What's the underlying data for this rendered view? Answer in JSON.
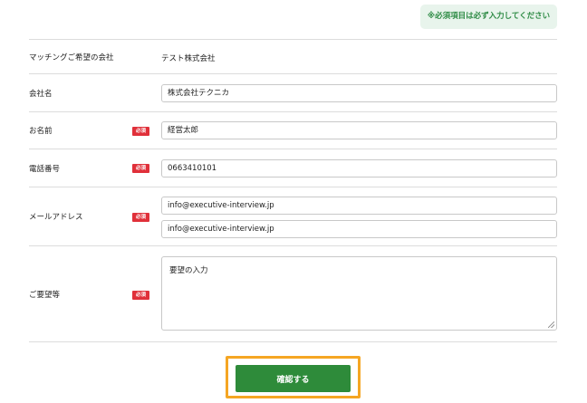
{
  "notice": "※必須項目は必ず入力してください",
  "required_badge": "必須",
  "fields": {
    "company_wish": {
      "label": "マッチングご希望の会社",
      "value": "テスト株式会社"
    },
    "company_name": {
      "label": "会社名",
      "value": "株式会社テクニカ"
    },
    "name": {
      "label": "お名前",
      "value": "経営太郎"
    },
    "phone": {
      "label": "電話番号",
      "value": "0663410101"
    },
    "email": {
      "label": "メールアドレス",
      "value": "info@executive-interview.jp",
      "confirm_value": "info@executive-interview.jp"
    },
    "request": {
      "label": "ご要望等",
      "value": "要望の入力"
    }
  },
  "submit_label": "確認する",
  "colors": {
    "required": "#e0303a",
    "submit": "#2e8b3a",
    "highlight": "#f5a623",
    "notice_text": "#2e8b45"
  }
}
